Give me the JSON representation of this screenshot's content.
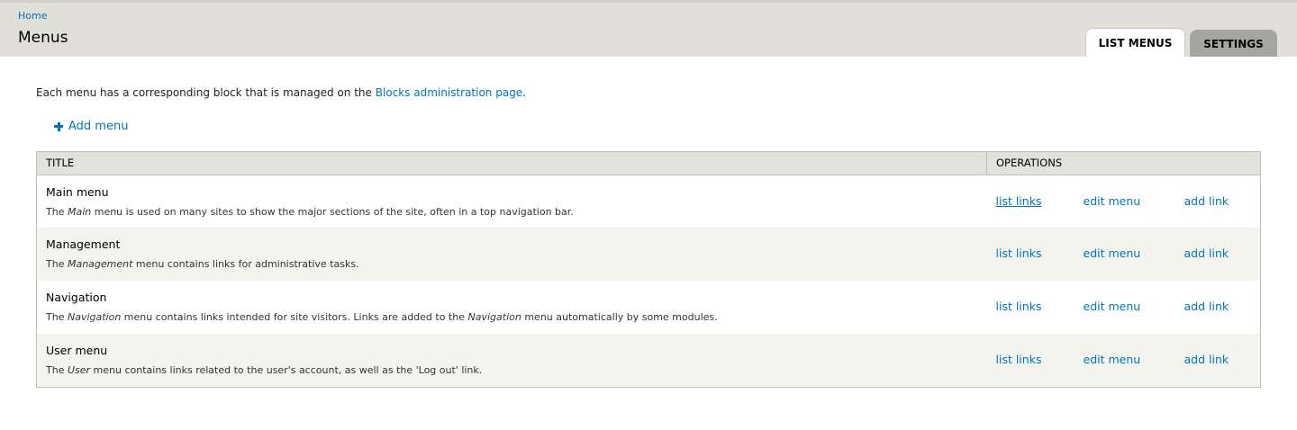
{
  "header": {
    "breadcrumb": "Home",
    "title": "Menus",
    "tabs": [
      {
        "label": "LIST MENUS",
        "active": true
      },
      {
        "label": "SETTINGS",
        "active": false
      }
    ]
  },
  "intro": {
    "text": "Each menu has a corresponding block that is managed on the ",
    "link": "Blocks administration page",
    "suffix": "."
  },
  "add_menu": {
    "label": "Add menu",
    "icon": "plus-icon"
  },
  "table": {
    "headers": {
      "title": "TITLE",
      "operations": "OPERATIONS"
    },
    "rows": [
      {
        "name": "Main menu",
        "desc": {
          "pre": "The ",
          "em": "Main",
          "post": " menu is used on many sites to show the major sections of the site, often in a top navigation bar.",
          "em2": "",
          "post2": ""
        },
        "ops": {
          "list": "list links",
          "edit": "edit menu",
          "add": "add link"
        }
      },
      {
        "name": "Management",
        "desc": {
          "pre": "The ",
          "em": "Management",
          "post": " menu contains links for administrative tasks.",
          "em2": "",
          "post2": ""
        },
        "ops": {
          "list": "list links",
          "edit": "edit menu",
          "add": "add link"
        }
      },
      {
        "name": "Navigation",
        "desc": {
          "pre": "The ",
          "em": "Navigation",
          "post": " menu contains links intended for site visitors. Links are added to the ",
          "em2": "Navigation",
          "post2": " menu automatically by some modules."
        },
        "ops": {
          "list": "list links",
          "edit": "edit menu",
          "add": "add link"
        }
      },
      {
        "name": "User menu",
        "desc": {
          "pre": "The ",
          "em": "User",
          "post": " menu contains links related to the user's account, as well as the 'Log out' link.",
          "em2": "",
          "post2": ""
        },
        "ops": {
          "list": "list links",
          "edit": "edit menu",
          "add": "add link"
        }
      }
    ]
  },
  "colors": {
    "link": "#0074bd",
    "header_bg": "#e0e0d8",
    "row_alt": "#f3f4ee"
  }
}
